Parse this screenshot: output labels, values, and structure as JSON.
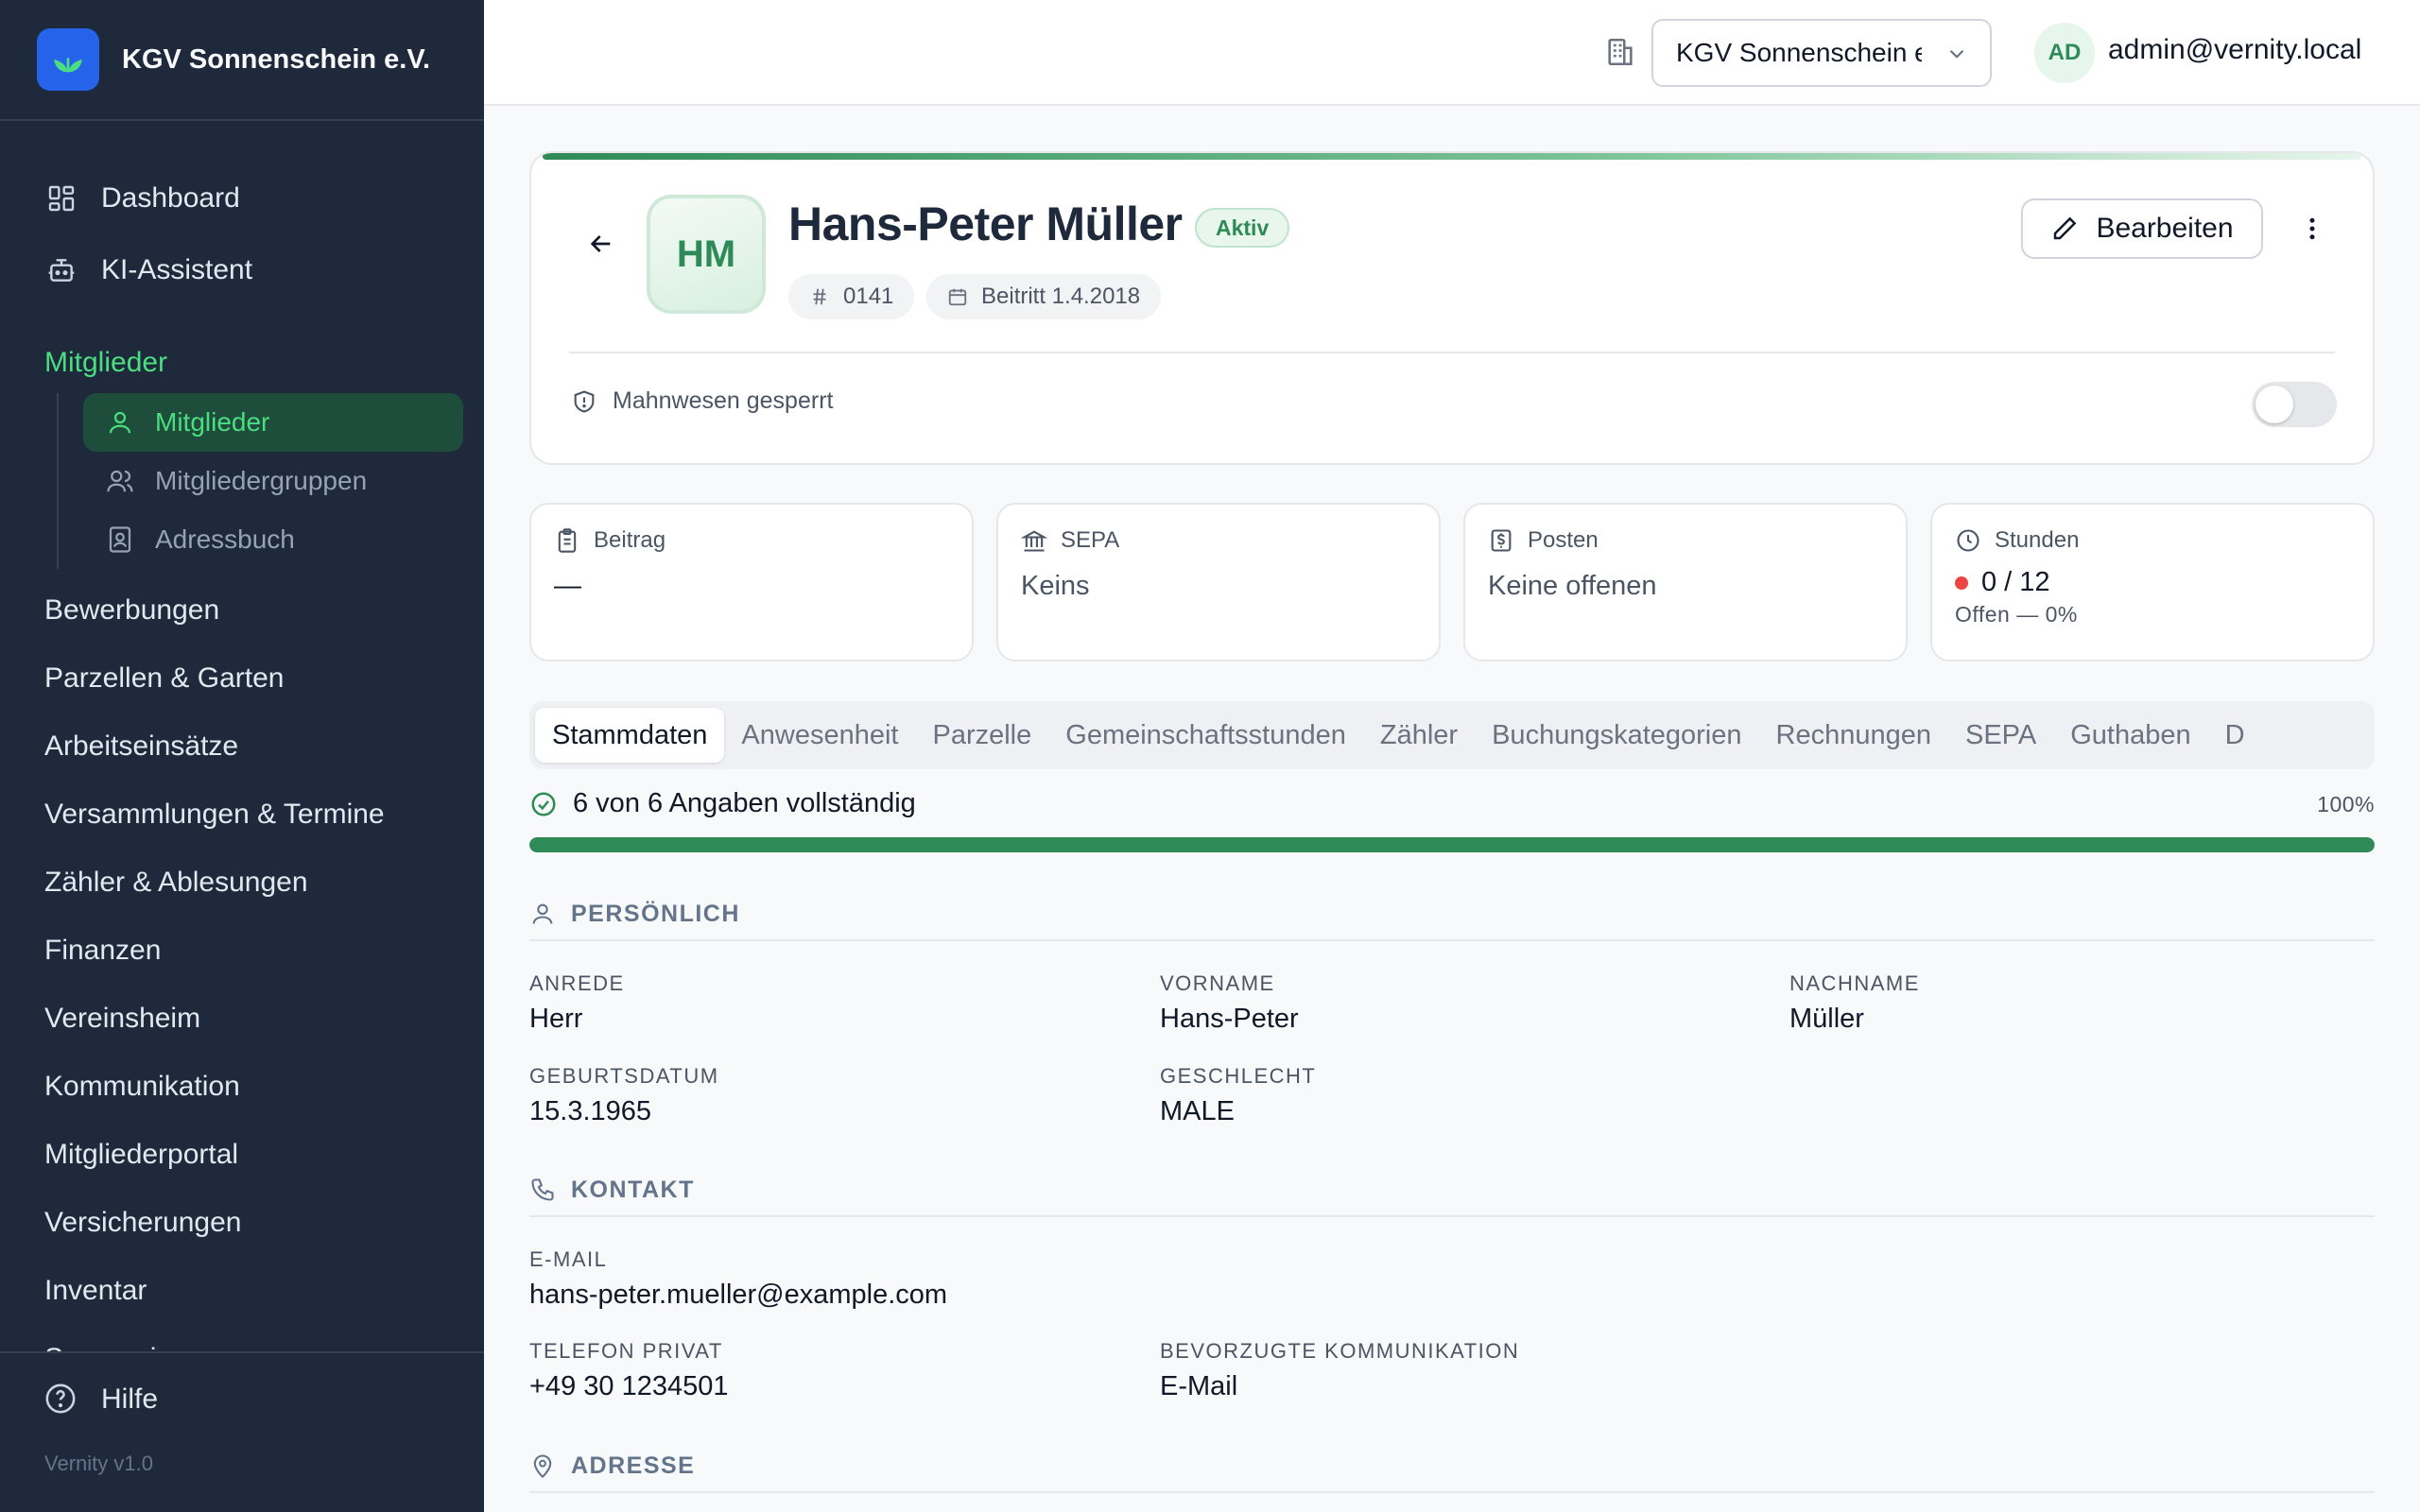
{
  "brand": {
    "name": "KGV Sonnenschein e.V."
  },
  "sidebar": {
    "top_items": [
      {
        "label": "Dashboard"
      },
      {
        "label": "KI-Assistent"
      }
    ],
    "group_title": "Mitglieder",
    "sub_items": [
      {
        "label": "Mitglieder",
        "active": true
      },
      {
        "label": "Mitgliedergruppen"
      },
      {
        "label": "Adressbuch"
      }
    ],
    "items": [
      {
        "label": "Bewerbungen"
      },
      {
        "label": "Parzellen & Garten"
      },
      {
        "label": "Arbeitseinsätze"
      },
      {
        "label": "Versammlungen & Termine"
      },
      {
        "label": "Zähler & Ablesungen"
      },
      {
        "label": "Finanzen"
      },
      {
        "label": "Vereinsheim"
      },
      {
        "label": "Kommunikation"
      },
      {
        "label": "Mitgliederportal"
      },
      {
        "label": "Versicherungen"
      },
      {
        "label": "Inventar"
      },
      {
        "label": "Sponsoring"
      }
    ],
    "help_label": "Hilfe",
    "version": "Vernity v1.0"
  },
  "topbar": {
    "org_select_value": "KGV Sonnenschein e.V.",
    "user_initials": "AD",
    "user_email": "admin@vernity.local"
  },
  "profile": {
    "initials": "HM",
    "name": "Hans-Peter Müller",
    "status": "Aktiv",
    "member_number": "0141",
    "joined": "Beitritt 1.4.2018",
    "edit_label": "Bearbeiten",
    "dunning_label": "Mahnwesen gesperrt",
    "dunning_locked": false
  },
  "stats": [
    {
      "title": "Beitrag",
      "value": "—"
    },
    {
      "title": "SEPA",
      "value": "Keins"
    },
    {
      "title": "Posten",
      "value": "Keine offenen"
    },
    {
      "title": "Stunden",
      "value": "0 / 12",
      "sub": "Offen — 0%"
    }
  ],
  "tabs": [
    {
      "label": "Stammdaten",
      "active": true
    },
    {
      "label": "Anwesenheit"
    },
    {
      "label": "Parzelle"
    },
    {
      "label": "Gemeinschaftsstunden"
    },
    {
      "label": "Zähler"
    },
    {
      "label": "Buchungskategorien"
    },
    {
      "label": "Rechnungen"
    },
    {
      "label": "SEPA"
    },
    {
      "label": "Guthaben"
    },
    {
      "label": "D"
    }
  ],
  "completion": {
    "text": "6 von 6 Angaben vollständig",
    "percent_label": "100%",
    "fraction": 1.0
  },
  "sections": {
    "personal": {
      "title": "PERSÖNLICH",
      "fields": {
        "anrede": {
          "label": "ANREDE",
          "value": "Herr"
        },
        "vorname": {
          "label": "VORNAME",
          "value": "Hans-Peter"
        },
        "nachname": {
          "label": "NACHNAME",
          "value": "Müller"
        },
        "geburtsdatum": {
          "label": "GEBURTSDATUM",
          "value": "15.3.1965"
        },
        "geschlecht": {
          "label": "GESCHLECHT",
          "value": "MALE"
        }
      }
    },
    "contact": {
      "title": "KONTAKT",
      "fields": {
        "email": {
          "label": "E-MAIL",
          "value": "hans-peter.mueller@example.com"
        },
        "telefon": {
          "label": "TELEFON PRIVAT",
          "value": "+49 30 1234501"
        },
        "kommunikation": {
          "label": "BEVORZUGTE KOMMUNIKATION",
          "value": "E-Mail"
        }
      }
    },
    "address": {
      "title": "ADRESSE"
    }
  },
  "colors": {
    "accent": "#2e8b57",
    "sidebar_bg": "#1e293b",
    "active_green": "#4ade80",
    "danger": "#ef4444"
  }
}
